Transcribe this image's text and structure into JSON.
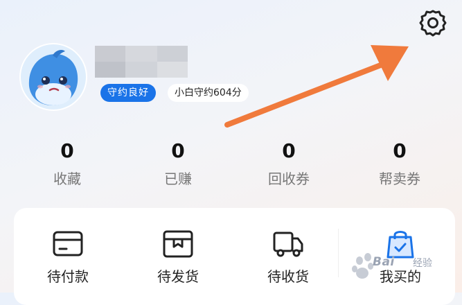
{
  "user": {
    "credit_badge": "守约良好",
    "score_badge": "小白守约604分"
  },
  "stats": [
    {
      "value": "0",
      "label": "收藏"
    },
    {
      "value": "0",
      "label": "已赚"
    },
    {
      "value": "0",
      "label": "回收券"
    },
    {
      "value": "0",
      "label": "帮卖券"
    }
  ],
  "orders": [
    {
      "label": "待付款",
      "icon": "card-icon"
    },
    {
      "label": "待发货",
      "icon": "package-icon"
    },
    {
      "label": "待收货",
      "icon": "truck-icon"
    },
    {
      "label": "我买的",
      "icon": "shopping-bag-icon"
    }
  ],
  "watermark": {
    "brand": "Bai",
    "suffix": "经验"
  },
  "colors": {
    "accent": "#1a73e8",
    "arrow": "#f07a3c"
  }
}
